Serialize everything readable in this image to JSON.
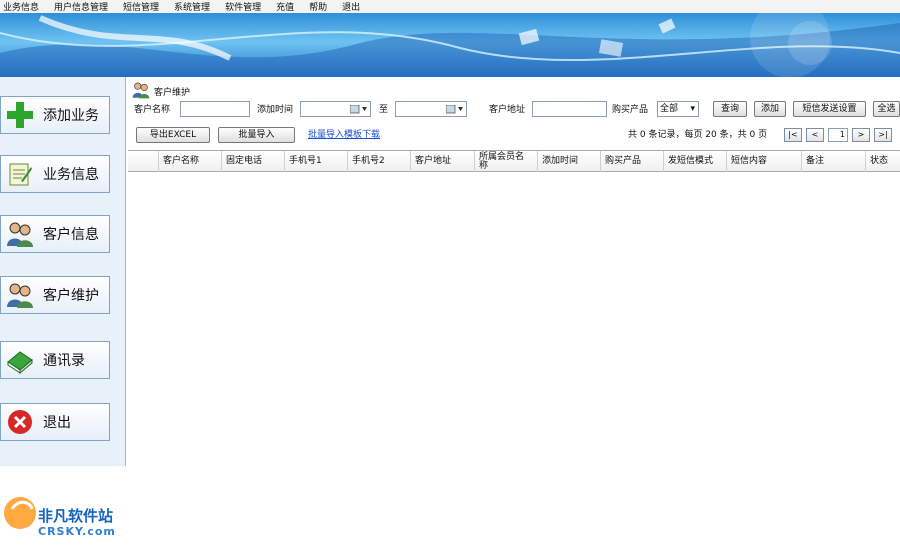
{
  "menu": [
    "业务信息",
    "用户信息管理",
    "短信管理",
    "系统管理",
    "软件管理",
    "充值",
    "帮助",
    "退出"
  ],
  "sidebar": [
    {
      "label": "添加业务",
      "icon": "plus-icon"
    },
    {
      "label": "业务信息",
      "icon": "notepad-icon"
    },
    {
      "label": "客户信息",
      "icon": "users-icon"
    },
    {
      "label": "客户维护",
      "icon": "users-icon"
    },
    {
      "label": "通讯录",
      "icon": "book-icon"
    },
    {
      "label": "退出",
      "icon": "exit-icon"
    }
  ],
  "panel": {
    "title": "客户维护",
    "icon": "users-icon"
  },
  "filters": {
    "customer_name_label": "客户名称",
    "customer_name_value": "",
    "add_time_label": "添加时间",
    "to_label": "至",
    "address_label": "客户地址",
    "address_value": "",
    "product_label": "购买产品",
    "product_selected": "全部"
  },
  "buttons": {
    "query": "查询",
    "add": "添加",
    "sms_settings": "短信发送设置",
    "select_all": "全选",
    "export_excel": "导出EXCEL",
    "batch_import": "批量导入",
    "template_download": "批量导入模板下载"
  },
  "pagination": {
    "summary": "共 0 条记录，每页 20 条，共 0 页",
    "current_page": "1",
    "first": "|<",
    "prev": "<",
    "next": ">",
    "last": ">|"
  },
  "table": {
    "columns": [
      "客户名称",
      "固定电话",
      "手机号1",
      "手机号2",
      "客户地址",
      "所属会员名称",
      "添加时间",
      "购买产品",
      "发短信模式",
      "短信内容",
      "备注",
      "状态"
    ],
    "rows": []
  },
  "watermark": {
    "brand": "非凡软件站",
    "domain": "CRSKY.com"
  }
}
